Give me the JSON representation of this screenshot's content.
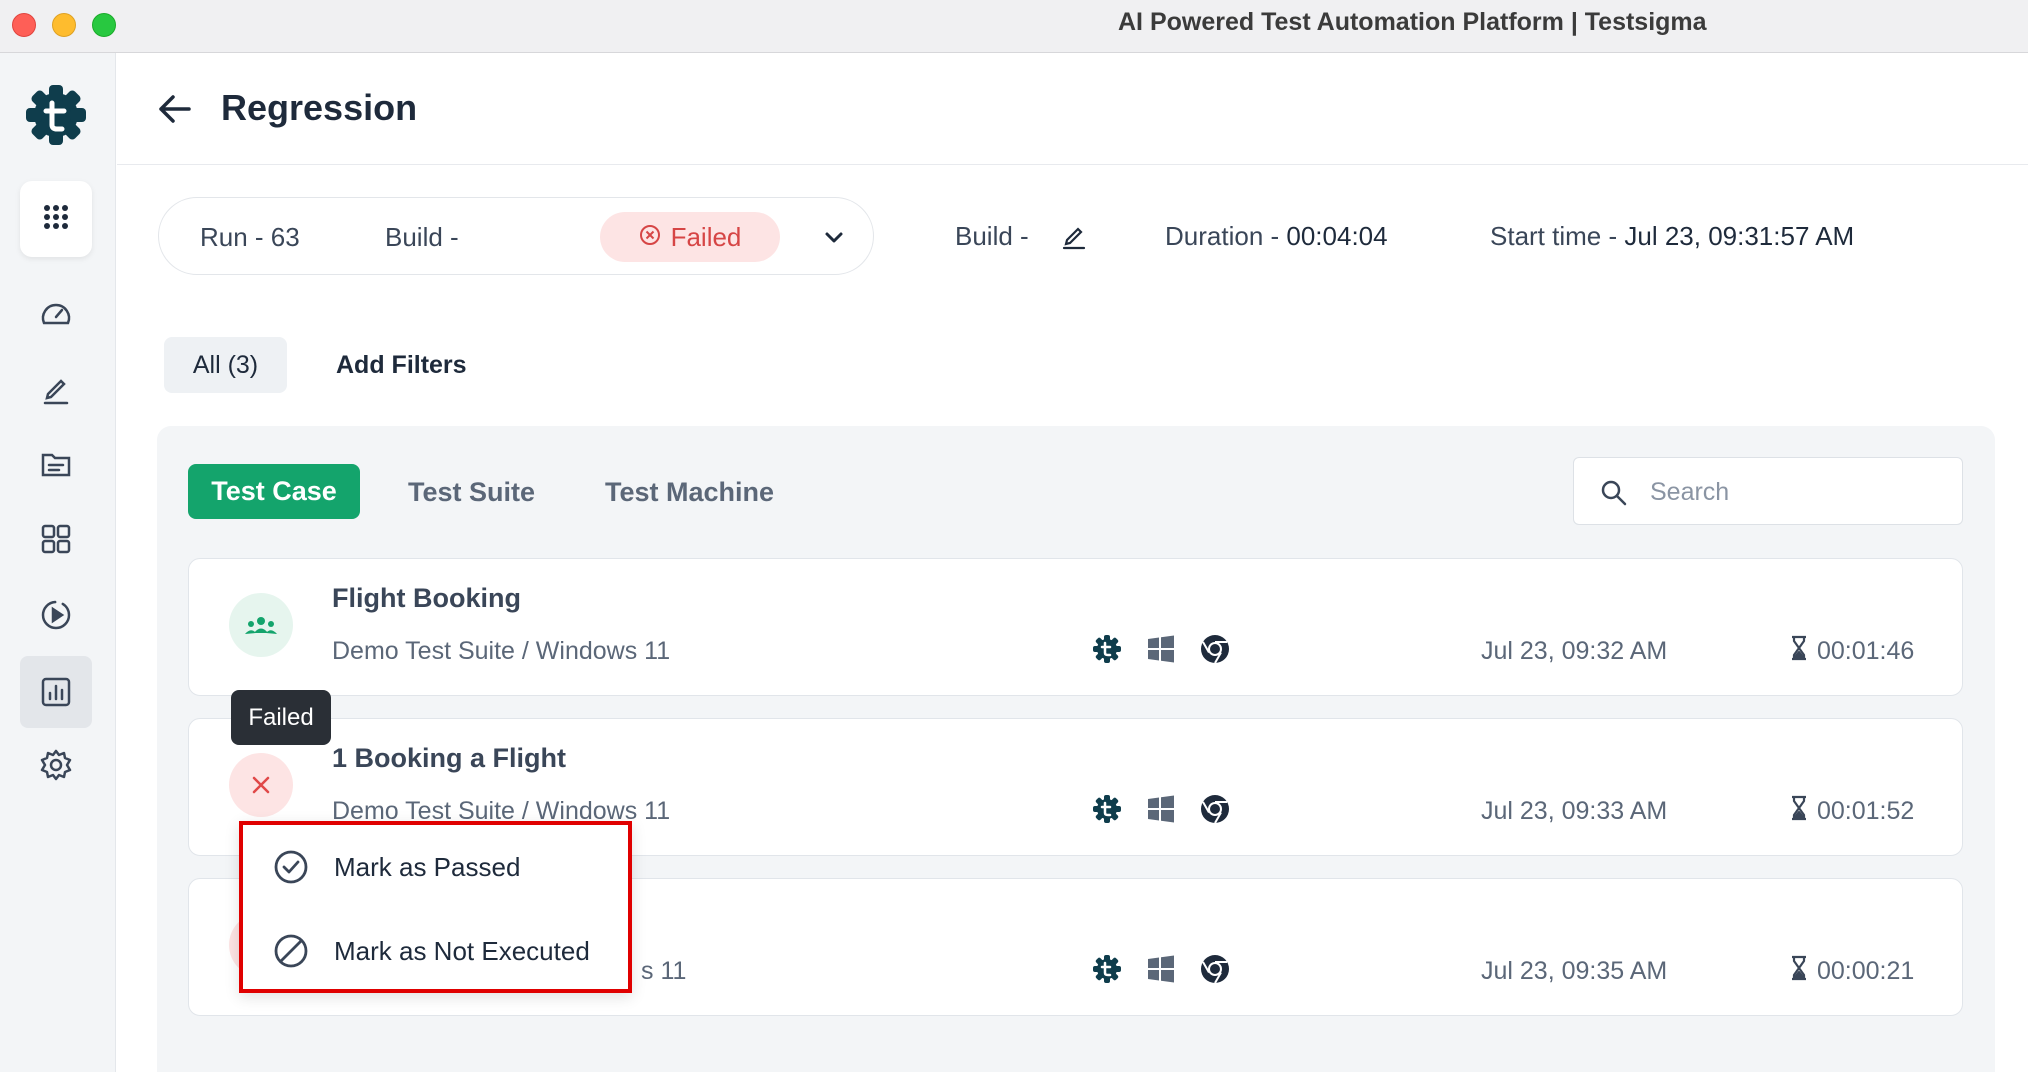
{
  "window": {
    "title": "AI Powered Test Automation Platform | Testsigma"
  },
  "sidebar": {
    "items": [
      {
        "name": "apps-grid-icon"
      },
      {
        "name": "dashboard-speedometer-icon"
      },
      {
        "name": "edit-pen-icon"
      },
      {
        "name": "folder-list-icon"
      },
      {
        "name": "grid-modules-icon"
      },
      {
        "name": "play-run-icon"
      },
      {
        "name": "reports-chart-icon",
        "active": true
      },
      {
        "name": "settings-gear-icon"
      }
    ]
  },
  "header": {
    "title": "Regression"
  },
  "run": {
    "run_label": "Run - 63",
    "build_label": "Build -",
    "status": "Failed",
    "build2_label": "Build -",
    "duration_label": "Duration -",
    "duration_value": "00:04:04",
    "start_label": "Start time -",
    "start_value": "Jul 23, 09:31:57 AM"
  },
  "filters": {
    "all": "All (3)",
    "add": "Add Filters"
  },
  "tabs": [
    {
      "label": "Test Case",
      "active": true
    },
    {
      "label": "Test Suite"
    },
    {
      "label": "Test Machine"
    }
  ],
  "search": {
    "placeholder": "Search"
  },
  "rows": [
    {
      "title": "Flight Booking",
      "subtitle": "Demo Test Suite / Windows 11",
      "time": "Jul 23, 09:32 AM",
      "duration": "00:01:46",
      "status": "queued"
    },
    {
      "title": "1 Booking a Flight",
      "subtitle": "Demo Test Suite / Windows 11",
      "time": "Jul 23, 09:33 AM",
      "duration": "00:01:52",
      "status": "failed"
    },
    {
      "title": "",
      "subtitle": "s 11",
      "time": "Jul 23, 09:35 AM",
      "duration": "00:00:21",
      "status": "failed"
    }
  ],
  "tooltip": {
    "text": "Failed"
  },
  "menu": {
    "items": [
      {
        "label": "Mark as Passed",
        "icon": "check-circle-icon"
      },
      {
        "label": "Mark as Not Executed",
        "icon": "ban-circle-icon"
      }
    ]
  },
  "colors": {
    "accent": "#14a46c",
    "failed": "#d64545",
    "highlight": "#e00000"
  }
}
